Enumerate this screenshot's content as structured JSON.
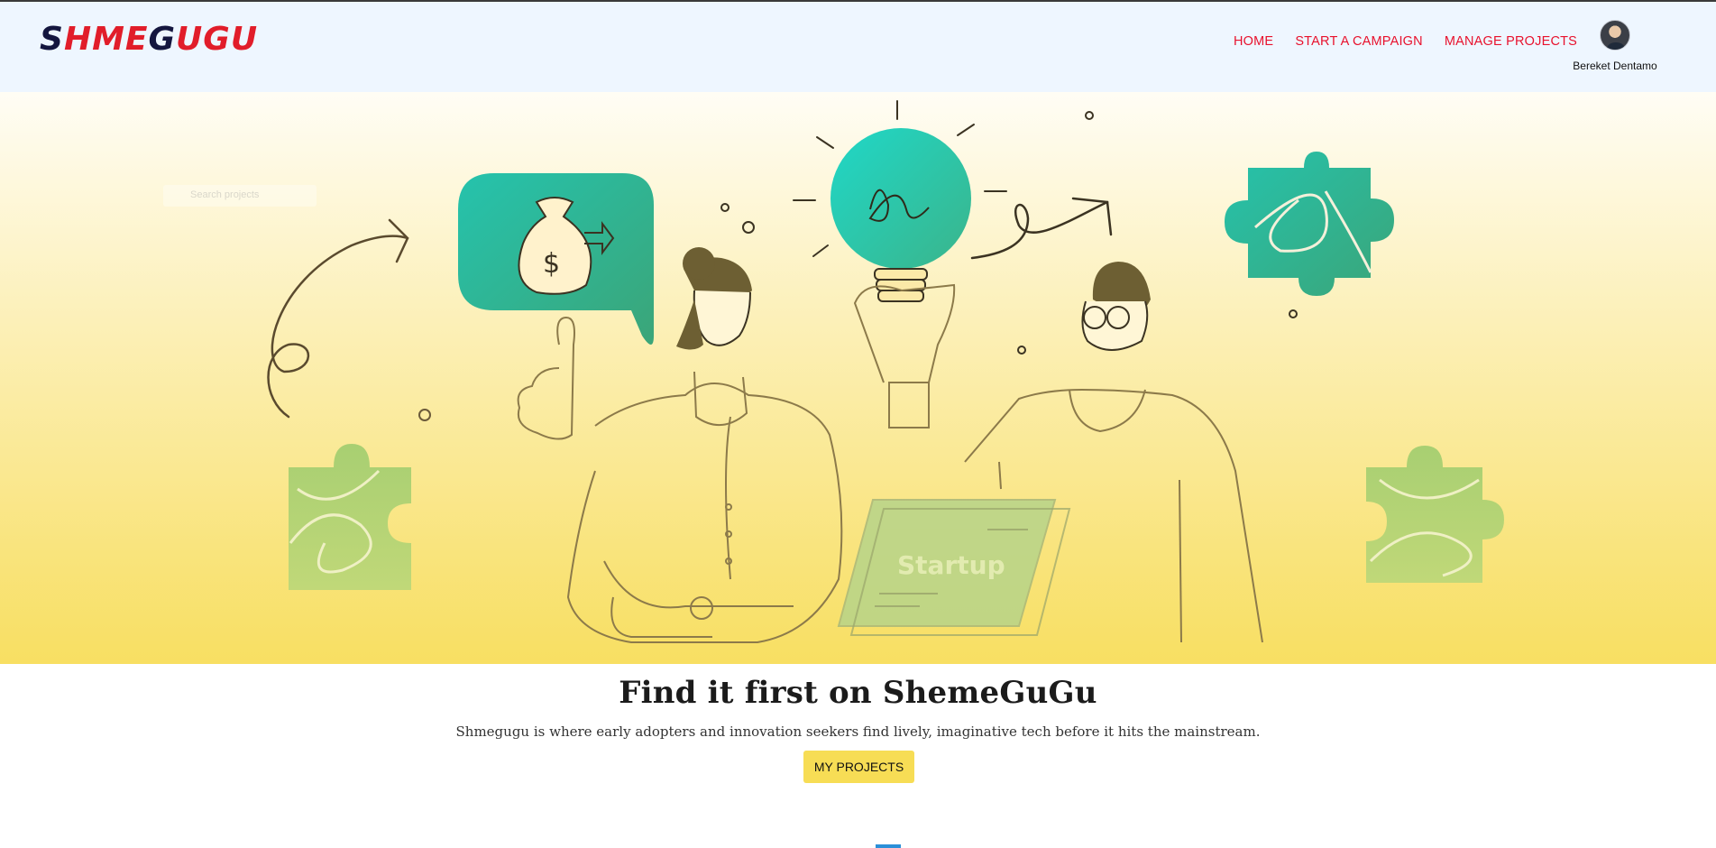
{
  "brand": {
    "logo_text_part1": "S",
    "logo_text_part2": "HME",
    "logo_text_part3": "G",
    "logo_text_part4": "UGU"
  },
  "nav": {
    "links": [
      {
        "label": "HOME"
      },
      {
        "label": "START A CAMPAIGN"
      },
      {
        "label": "MANAGE PROJECTS"
      }
    ]
  },
  "user": {
    "name": "Bereket Dentamo"
  },
  "hero": {
    "illustration_label": "Startup",
    "search_placeholder": "Search projects"
  },
  "main": {
    "headline": "Find it first on ShemeGuGu",
    "tagline": "Shmegugu is where early adopters and innovation seekers find lively, imaginative tech before it hits the mainstream.",
    "cta_label": "MY PROJECTS"
  },
  "colors": {
    "accent_red": "#e8112d",
    "logo_navy": "#14163f",
    "cta_yellow": "#f7dd55",
    "teal": "#1fc1b0",
    "nav_bg": "#eef6ff"
  },
  "icons": [
    "avatar",
    "money-bag-icon",
    "lightbulb-icon",
    "puzzle-piece-icon",
    "arrow-icon",
    "laptop-icon"
  ]
}
